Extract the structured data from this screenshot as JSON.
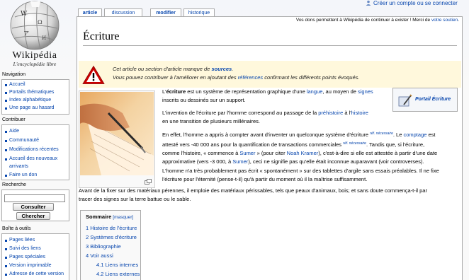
{
  "personal": {
    "create_account": "Créer un compte ou se connecter",
    "user_icon": "user-icon"
  },
  "logo": {
    "wordmark": "Wikipédia",
    "tagline": "L'encyclopédie libre",
    "icon": "globe-puzzle-icon"
  },
  "tabs": [
    {
      "label": "article",
      "selected": true
    },
    {
      "label": "discussion",
      "selected": false
    },
    {
      "label": "modifier",
      "selected": false
    },
    {
      "label": "historique",
      "selected": false
    }
  ],
  "sitenotice": {
    "text": "Vos dons permettent à Wikipédia de continuer à exister ! Merci de ",
    "link": "votre soutien",
    "end": "."
  },
  "article": {
    "title": "Écriture",
    "warning": {
      "line1_pre": "Cet article ou section d'article manque de ",
      "line1_link": "sources",
      "line1_post": ".",
      "line2_pre": "Vous pouvez contribuer à l'améliorer en ajoutant des ",
      "line2_link": "références",
      "line2_post": " confirmant les différents points évoqués.",
      "icon": "warning-triangle-icon"
    },
    "portail": {
      "label": "Portail Écriture",
      "icon": "portail-ink-icon"
    },
    "thumb": {
      "image": "handwriting-photo",
      "icon": "magnify-clip-icon"
    },
    "p1": {
      "a": "L'",
      "b": "écriture",
      "c": " est un système de représentation graphique d'une ",
      "d": "langue",
      "e": ", au moyen de ",
      "f": "signes",
      "g": "inscrits ou dessinés sur un support."
    },
    "p2": {
      "a": "L'invention de l'écriture par l'homme correspond au passage de la ",
      "b": "préhistoire",
      "c": " à l'",
      "d": "histoire",
      "e": "en une transition de plusieurs millénaires."
    },
    "p3": {
      "l1a": "En effet, l'homme a appris à compter avant d'inventer un quelconque système d'écriture",
      "l1sup": "réf. nécessaire",
      "l1b": ". Le ",
      "l1c": "comptage",
      "l1d": " est",
      "l2a": "attesté vers -40 000 ans pour la quantification de transactions commerciales",
      "l2sup": "réf. nécessaire",
      "l2b": ". Tandis que, si l'écriture,",
      "l3a": "comme l'histoire, « commence à ",
      "l3b": "Sumer",
      "l3c": " » (pour citer ",
      "l3d": "Noah Kramer",
      "l3e": "), c'est-à-dire si elle est attestée à partir d'une date",
      "l4a": "approximative (vers -3 000, à ",
      "l4b": "Sumer",
      "l4c": "), ceci ne signifie pas qu'elle était inconnue auparavant (voir controverses)."
    },
    "p4": {
      "l1": "L'homme n'a très probablement pas écrit « spontanément » sur des tablettes d'argile sans essais préalables. Il ne fixe",
      "l2": "l'écriture pour l'éternité (pense-t-il) qu'à partir du moment où il la maîtrise suffisamment."
    },
    "p5": {
      "l1": "Avant de la fixer sur des matériaux pérennes, il emploie des matériaux périssables, tels que peaux d'animaux, bois; et sans doute commença-t-il par",
      "l2": "tracer des signes sur la terre battue ou le sable."
    },
    "toc": {
      "title": "Sommaire",
      "toggle": "[masquer]",
      "items": [
        "1 Histoire de l'écriture",
        "2 Systèmes d'écriture",
        "3 Bibliographie",
        "4 Voir aussi",
        "4.1 Liens internes",
        "4.2 Liens externes"
      ]
    }
  },
  "sidebar": {
    "navigation": {
      "heading": "Navigation",
      "items": [
        "Accueil",
        "Portails thématiques",
        "Index alphabétique",
        "Une page au hasard"
      ]
    },
    "contribuer": {
      "heading": "Contribuer",
      "items": [
        "Aide",
        "Communauté",
        "Modifications récentes",
        "Accueil des nouveaux",
        "arrivants",
        "Faire un don"
      ]
    },
    "recherche": {
      "heading": "Recherche",
      "search_value": "",
      "go_label": "Consulter",
      "search_label": "Chercher"
    },
    "toolbox": {
      "heading": "Boîte à outils",
      "items": [
        "Pages liées",
        "Suivi des liens",
        "Pages spéciales",
        "Version imprimable",
        "Adresse de cette version"
      ]
    }
  },
  "colors": {
    "link": "#0645ad",
    "warning_bg": "#fff8dc",
    "warning_red": "#cc0000"
  }
}
